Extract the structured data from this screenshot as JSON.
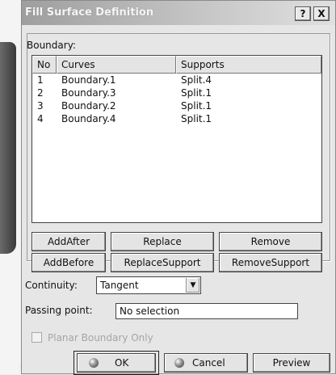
{
  "dialog": {
    "title": "Fill Surface Definition",
    "help_label": "?",
    "close_label": "X"
  },
  "boundary": {
    "label": "Boundary:",
    "columns": [
      "No",
      "Curves",
      "Supports"
    ],
    "rows": [
      {
        "no": "1",
        "curve": "Boundary.1",
        "support": "Split.4"
      },
      {
        "no": "2",
        "curve": "Boundary.3",
        "support": "Split.1"
      },
      {
        "no": "3",
        "curve": "Boundary.2",
        "support": "Split.1"
      },
      {
        "no": "4",
        "curve": "Boundary.4",
        "support": "Split.1"
      }
    ]
  },
  "buttons": {
    "add_after": "AddAfter",
    "replace": "Replace",
    "remove": "Remove",
    "add_before": "AddBefore",
    "replace_support": "ReplaceSupport",
    "remove_support": "RemoveSupport"
  },
  "continuity": {
    "label": "Continuity:",
    "value": "Tangent"
  },
  "passing_point": {
    "label": "Passing point:",
    "value": "No selection"
  },
  "planar_boundary": {
    "label": "Planar Boundary Only",
    "checked": false,
    "enabled": false
  },
  "footer": {
    "ok": "OK",
    "cancel": "Cancel",
    "preview": "Preview"
  }
}
